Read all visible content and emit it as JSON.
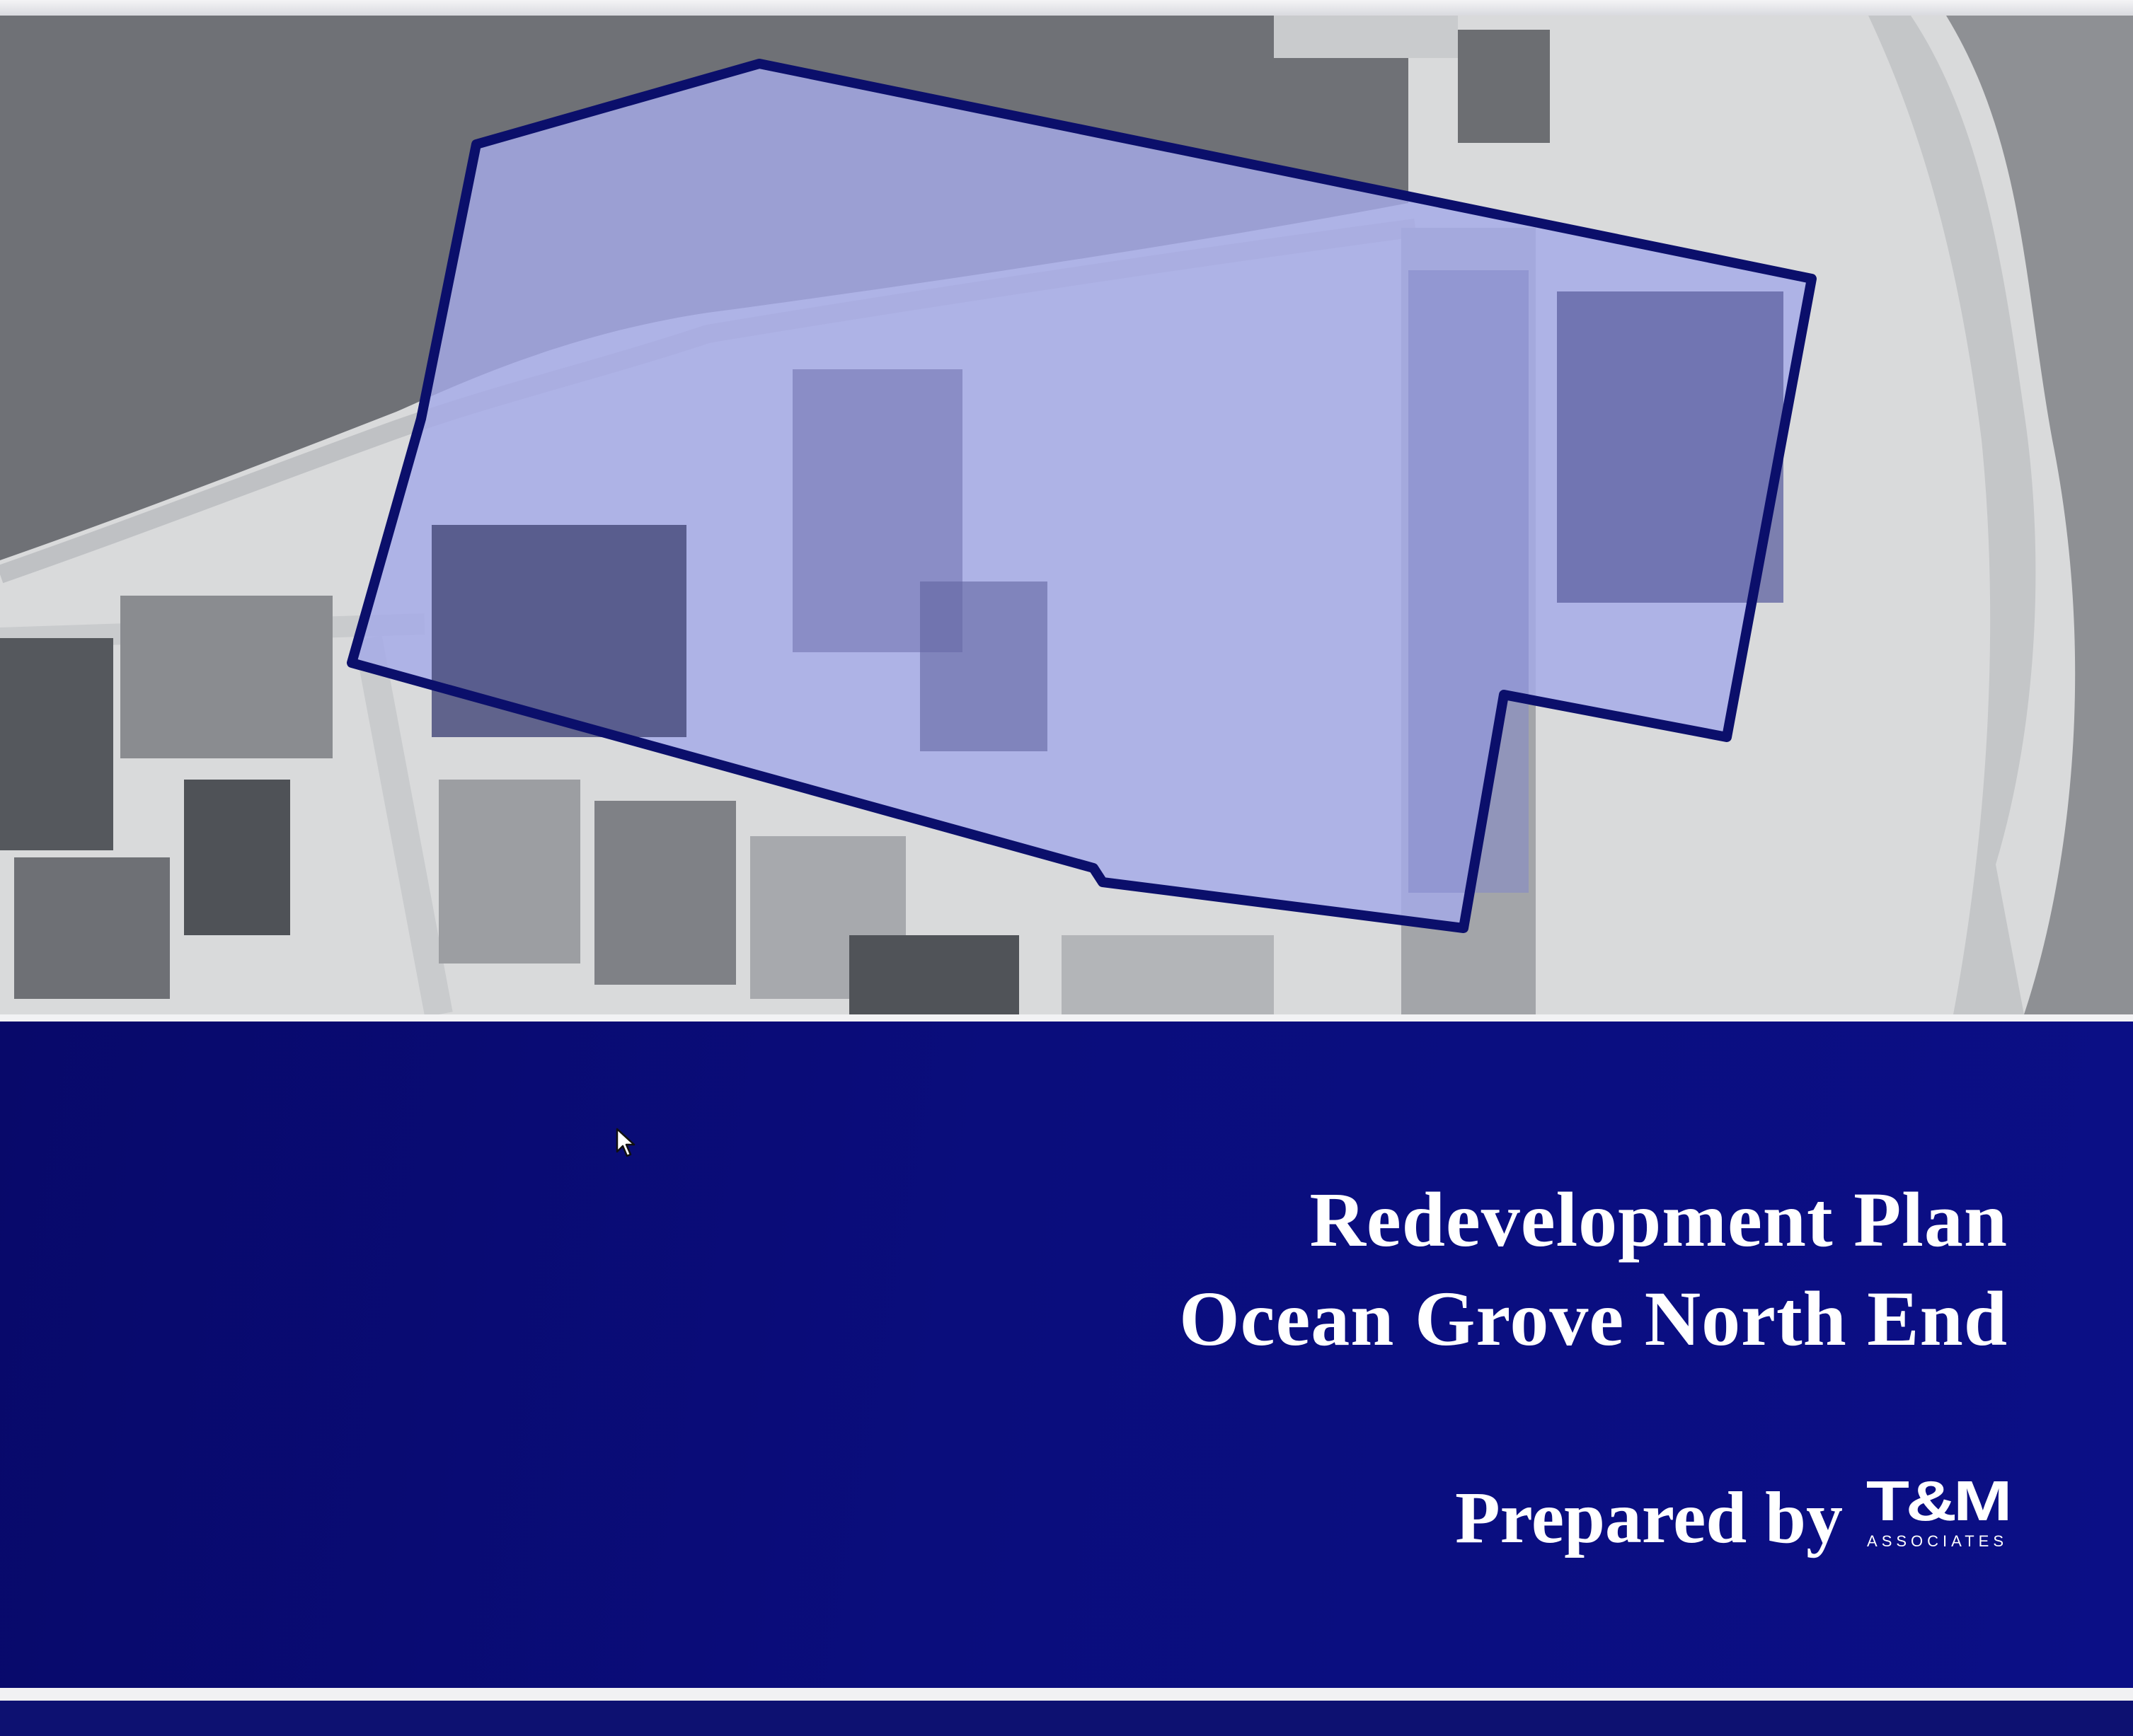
{
  "slide": {
    "title_line1": "Redevelopment Plan",
    "title_line2": "Ocean Grove North End",
    "prepared_by": "Prepared by",
    "logo": {
      "mark": "T&M",
      "subtitle": "ASSOCIATES"
    }
  },
  "colors": {
    "panel": "#0a0d7c",
    "boundary": "#0b0f6b",
    "overlay": "#9ba0e6",
    "text": "#ffffff"
  },
  "icons": {
    "cursor": "mouse-pointer-icon"
  }
}
